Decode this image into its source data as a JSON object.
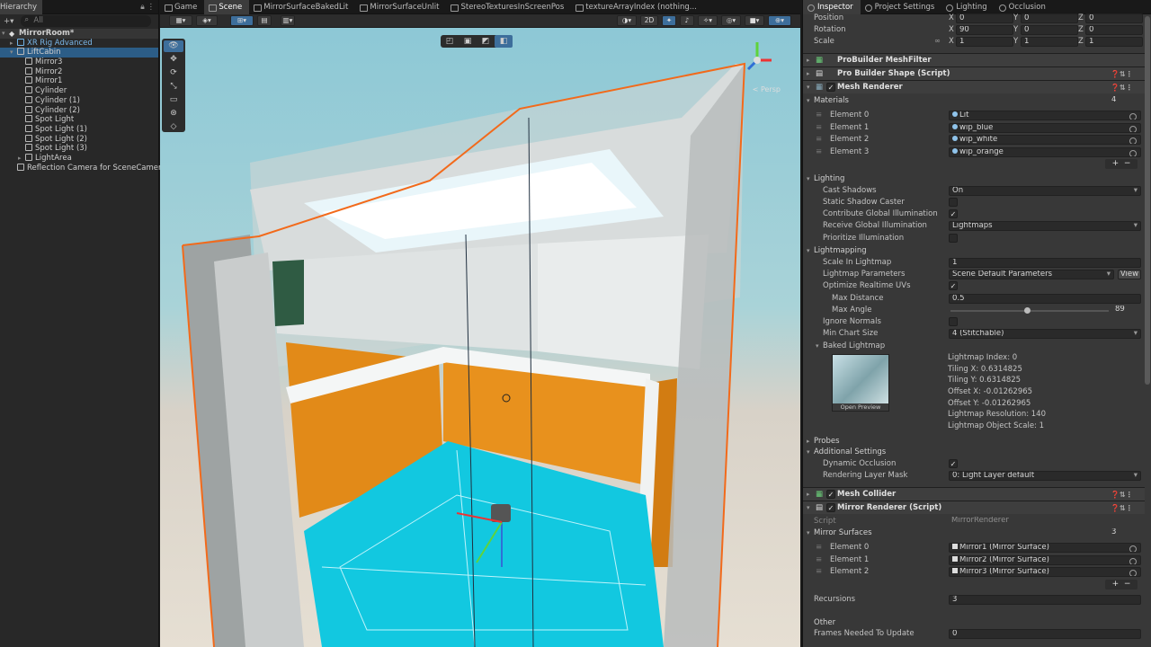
{
  "hierarchy": {
    "tab": "Hierarchy",
    "search_placeholder": "All",
    "items": [
      {
        "label": "MirrorRoom*",
        "depth": 0,
        "icon": "unity-scene-icon"
      },
      {
        "label": "XR Rig Advanced",
        "depth": 1,
        "icon": "prefab-icon"
      },
      {
        "label": "LiftCabin",
        "depth": 1,
        "icon": "gameobject-icon"
      },
      {
        "label": "Mirror3",
        "depth": 2,
        "icon": "gameobject-icon"
      },
      {
        "label": "Mirror2",
        "depth": 2,
        "icon": "gameobject-icon"
      },
      {
        "label": "Mirror1",
        "depth": 2,
        "icon": "gameobject-icon"
      },
      {
        "label": "Cylinder",
        "depth": 2,
        "icon": "gameobject-icon"
      },
      {
        "label": "Cylinder (1)",
        "depth": 2,
        "icon": "gameobject-icon"
      },
      {
        "label": "Cylinder (2)",
        "depth": 2,
        "icon": "gameobject-icon"
      },
      {
        "label": "Spot Light",
        "depth": 2,
        "icon": "gameobject-icon"
      },
      {
        "label": "Spot Light (1)",
        "depth": 2,
        "icon": "gameobject-icon"
      },
      {
        "label": "Spot Light (2)",
        "depth": 2,
        "icon": "gameobject-icon"
      },
      {
        "label": "Spot Light (3)",
        "depth": 2,
        "icon": "gameobject-icon"
      },
      {
        "label": "LightArea",
        "depth": 2,
        "icon": "gameobject-icon"
      },
      {
        "label": "Reflection Camera for SceneCamera",
        "depth": 1,
        "icon": "gameobject-icon"
      }
    ]
  },
  "view_tabs": [
    "Game",
    "Scene",
    "MirrorSurfaceBakedLit",
    "MirrorSurfaceUnlit",
    "StereoTexturesInScreenPos",
    "textureArrayIndex (nothing..."
  ],
  "scene_toolbar": {
    "mode_2d": "2D"
  },
  "scene": {
    "persp_label": "< Persp"
  },
  "inspector": {
    "tabs": [
      "Inspector",
      "Project Settings",
      "Lighting",
      "Occlusion"
    ],
    "transform": {
      "position": {
        "label": "Position",
        "x": "0",
        "y": "0",
        "z": "0"
      },
      "rotation": {
        "label": "Rotation",
        "x": "90",
        "y": "0",
        "z": "0"
      },
      "scale": {
        "label": "Scale",
        "x": "1",
        "y": "1",
        "z": "1"
      }
    },
    "components": {
      "meshfilter": "ProBuilder MeshFilter",
      "shape": "Pro Builder Shape (Script)",
      "renderer": "Mesh Renderer",
      "collider": "Mesh Collider",
      "mirror": "Mirror Renderer (Script)"
    },
    "materials": {
      "title": "Materials",
      "count": "4",
      "elements": [
        {
          "label": "Element 0",
          "value": "Lit"
        },
        {
          "label": "Element 1",
          "value": "wip_blue"
        },
        {
          "label": "Element 2",
          "value": "wip_white"
        },
        {
          "label": "Element 3",
          "value": "wip_orange"
        }
      ]
    },
    "lighting": {
      "title": "Lighting",
      "cast_shadows_label": "Cast Shadows",
      "cast_shadows": "On",
      "static_shadow_label": "Static Shadow Caster",
      "contribute_gi_label": "Contribute Global Illumination",
      "receive_gi_label": "Receive Global Illumination",
      "receive_gi": "Lightmaps",
      "prioritize_label": "Prioritize Illumination"
    },
    "lightmapping": {
      "title": "Lightmapping",
      "scale_label": "Scale In Lightmap",
      "scale": "1",
      "params_label": "Lightmap Parameters",
      "params": "Scene Default Parameters",
      "view_btn": "View",
      "optimize_label": "Optimize Realtime UVs",
      "max_distance_label": "Max Distance",
      "max_distance": "0.5",
      "max_angle_label": "Max Angle",
      "max_angle": "89",
      "ignore_normals_label": "Ignore Normals",
      "min_chart_label": "Min Chart Size",
      "min_chart": "4 (Stitchable)",
      "baked_label": "Baked Lightmap",
      "open_preview": "Open Preview",
      "info": [
        "Lightmap Index: 0",
        "Tiling X: 0.6314825",
        "Tiling Y: 0.6314825",
        "Offset X: -0.01262965",
        "Offset Y: -0.01262965",
        "Lightmap Resolution: 140",
        "Lightmap Object Scale: 1"
      ]
    },
    "probes": "Probes",
    "additional": {
      "title": "Additional Settings",
      "dynamic_occ_label": "Dynamic Occlusion",
      "layer_mask_label": "Rendering Layer Mask",
      "layer_mask": "0: Light Layer default"
    },
    "mirror_renderer": {
      "script_label": "Script",
      "script": "MirrorRenderer",
      "surfaces_title": "Mirror Surfaces",
      "surfaces_count": "3",
      "surfaces": [
        {
          "label": "Element 0",
          "value": "Mirror1 (Mirror Surface)"
        },
        {
          "label": "Element 1",
          "value": "Mirror2 (Mirror Surface)"
        },
        {
          "label": "Element 2",
          "value": "Mirror3 (Mirror Surface)"
        }
      ],
      "recursions_label": "Recursions",
      "recursions": "3",
      "other_title": "Other",
      "frames_label": "Frames Needed To Update",
      "frames": "0"
    }
  }
}
